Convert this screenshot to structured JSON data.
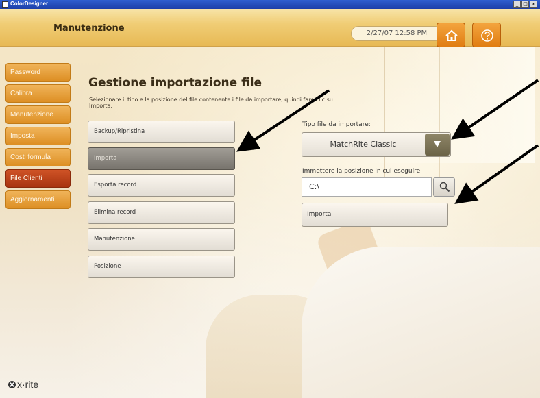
{
  "window": {
    "app_title": "ColorDesigner",
    "controls": [
      "_",
      "□",
      "x"
    ]
  },
  "header": {
    "title": "Manutenzione",
    "datetime": "2/27/07 12:58 PM",
    "home_icon": "home-icon",
    "help_icon": "help-icon"
  },
  "sidebar": {
    "items": [
      {
        "label": "Password",
        "active": false
      },
      {
        "label": "Calibra",
        "active": false
      },
      {
        "label": "Manutenzione",
        "active": false
      },
      {
        "label": "Imposta",
        "active": false
      },
      {
        "label": "Costi formula",
        "active": false
      },
      {
        "label": "File Clienti",
        "active": true
      },
      {
        "label": "Aggiornamenti",
        "active": false
      }
    ],
    "logo": "x·rite"
  },
  "main": {
    "title": "Gestione importazione file",
    "instructions": "Selezionare il tipo e la posizione del file contenente i file da importare, quindi fare clic su Importa.",
    "buttons": [
      {
        "label": "Backup/Ripristina",
        "selected": false
      },
      {
        "label": "Importa",
        "selected": true
      },
      {
        "label": "Esporta record",
        "selected": false
      },
      {
        "label": "Elimina record",
        "selected": false
      },
      {
        "label": "Manutenzione",
        "selected": false
      },
      {
        "label": "Posizione",
        "selected": false
      }
    ],
    "file_type_label": "Tipo file da importare:",
    "file_type_value": "MatchRite Classic",
    "location_label": "Immettere la posizione in cui eseguire",
    "location_value": "C:\\",
    "import_button": "Importa"
  },
  "colors": {
    "nav_orange": "#dd8f24",
    "nav_active": "#a83410",
    "header_gold": "#f0cd75"
  }
}
